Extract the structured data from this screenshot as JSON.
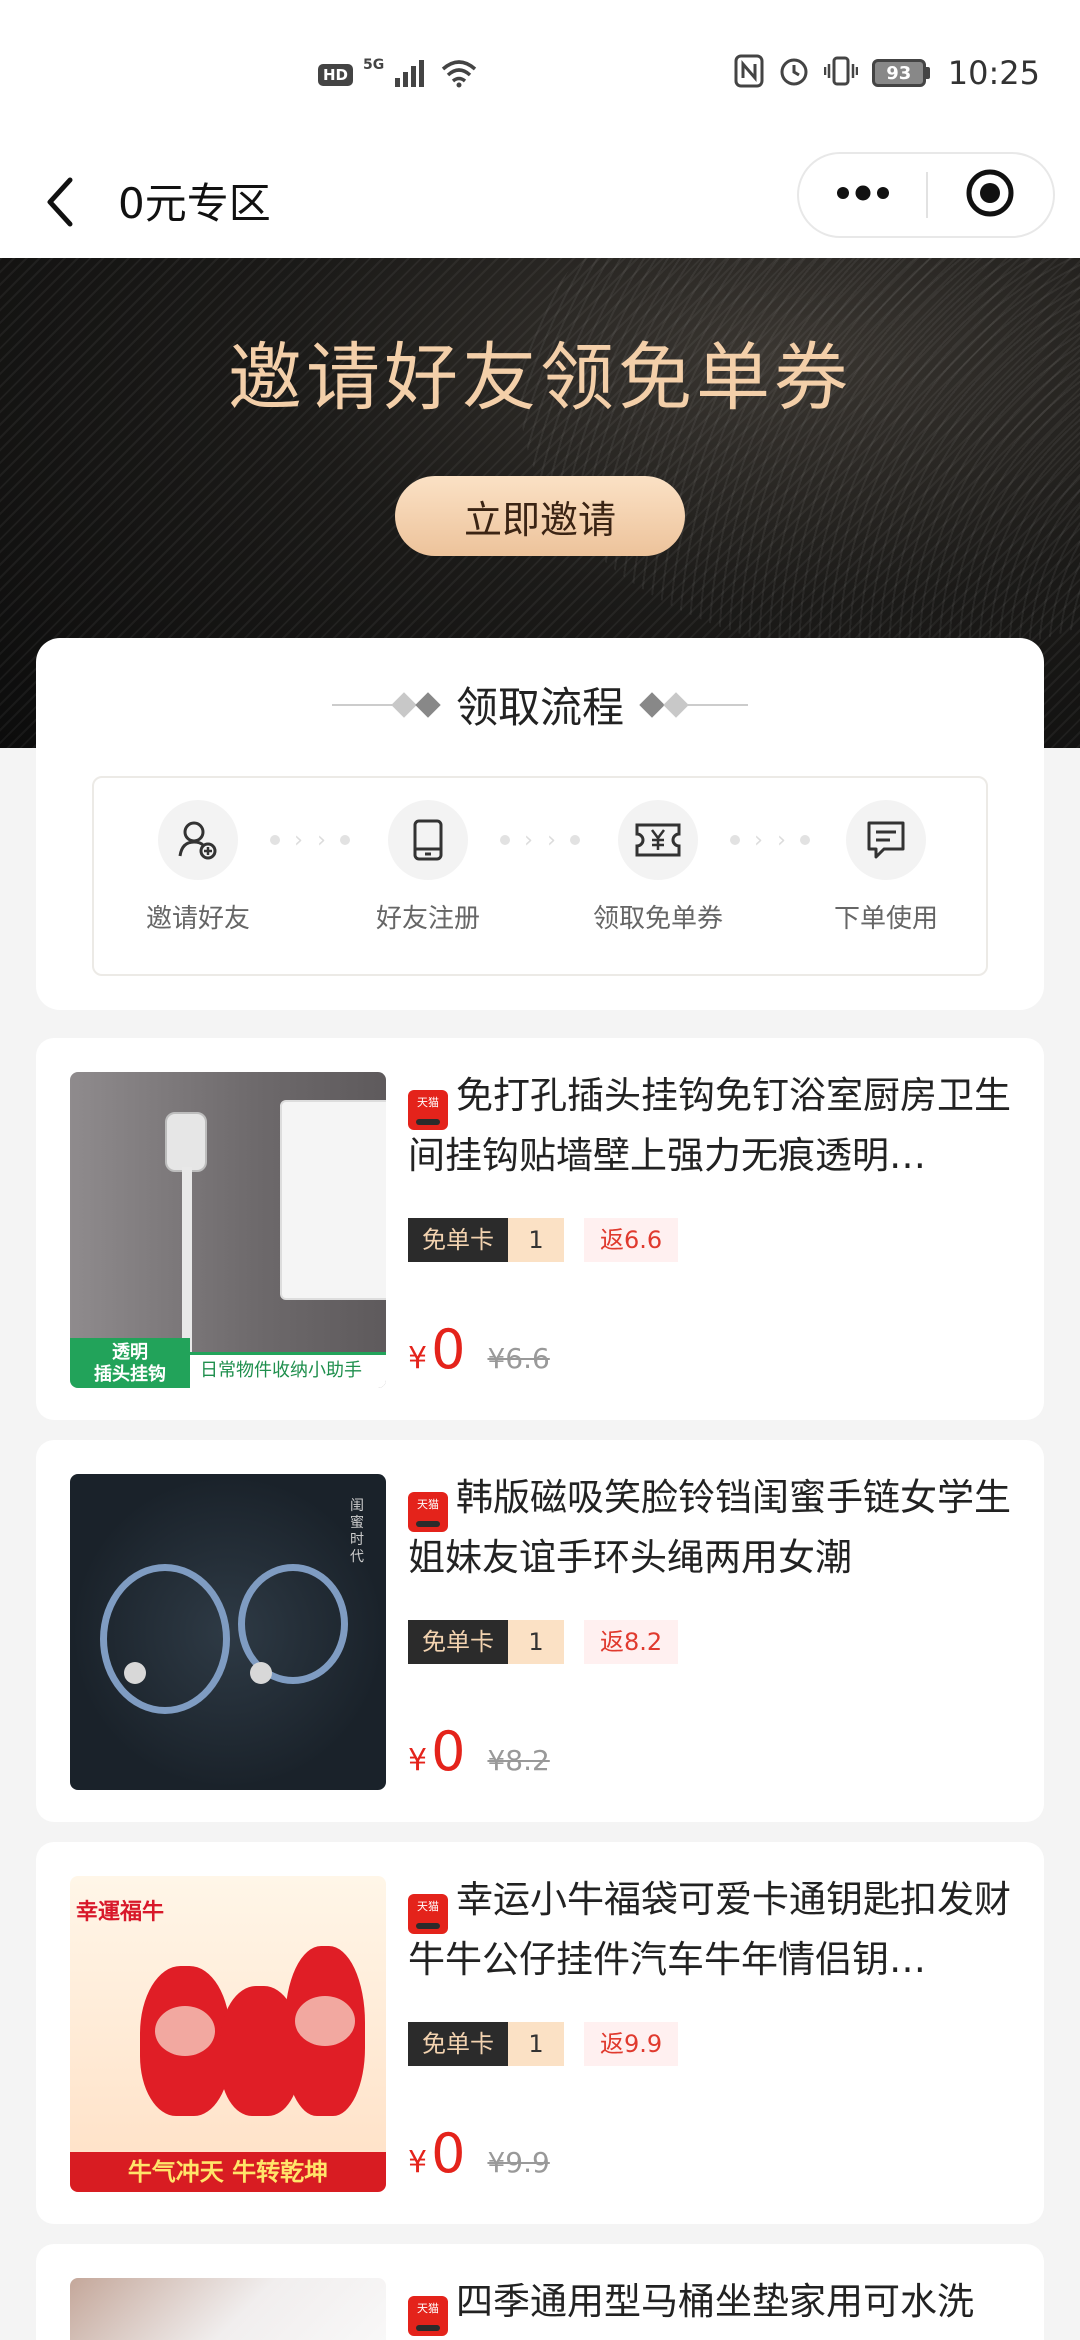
{
  "status_bar": {
    "left_badge": "HD",
    "network": "5G",
    "battery": "93",
    "time": "10:25"
  },
  "nav": {
    "title": "0元专区",
    "back_icon": "chevron-left-icon",
    "more_icon": "more-dots-icon",
    "close_icon": "target-circle-icon"
  },
  "banner": {
    "title": "邀请好友领免单券",
    "invite_button": "立即邀请"
  },
  "process": {
    "title": "领取流程",
    "steps": [
      {
        "label": "邀请好友",
        "icon": "user-add-icon"
      },
      {
        "label": "好友注册",
        "icon": "phone-icon"
      },
      {
        "label": "领取免单券",
        "icon": "ticket-yen-icon"
      },
      {
        "label": "下单使用",
        "icon": "message-order-icon"
      }
    ]
  },
  "products": [
    {
      "badge": "天猫",
      "title": "免打孔插头挂钩免钉浴室厨房卫生间挂钩贴墙壁上强力无痕透明…",
      "voucher_label": "免单卡",
      "voucher_count": "1",
      "rebate": "返6.6",
      "currency": "¥",
      "price": "0",
      "original_price": "¥6.6",
      "thumb_tag_line1": "透明",
      "thumb_tag_line2": "插头挂钩",
      "thumb_tag_text": "日常物件收纳小助手"
    },
    {
      "badge": "天猫",
      "title": "韩版磁吸笑脸铃铛闺蜜手链女学生姐妹友谊手环头绳两用女潮",
      "voucher_label": "免单卡",
      "voucher_count": "1",
      "rebate": "返8.2",
      "currency": "¥",
      "price": "0",
      "original_price": "¥8.2",
      "thumb_vertical_text": "闺蜜时代"
    },
    {
      "badge": "天猫",
      "title": "幸运小牛福袋可爱卡通钥匙扣发财牛牛公仔挂件汽车牛年情侣钥…",
      "voucher_label": "免单卡",
      "voucher_count": "1",
      "rebate": "返9.9",
      "currency": "¥",
      "price": "0",
      "original_price": "¥9.9",
      "thumb_top_text": "幸運福牛",
      "thumb_bottom_text": "牛气冲天 牛转乾坤"
    },
    {
      "badge": "天猫",
      "title": "四季通用型马桶坐垫家用可水洗"
    }
  ]
}
